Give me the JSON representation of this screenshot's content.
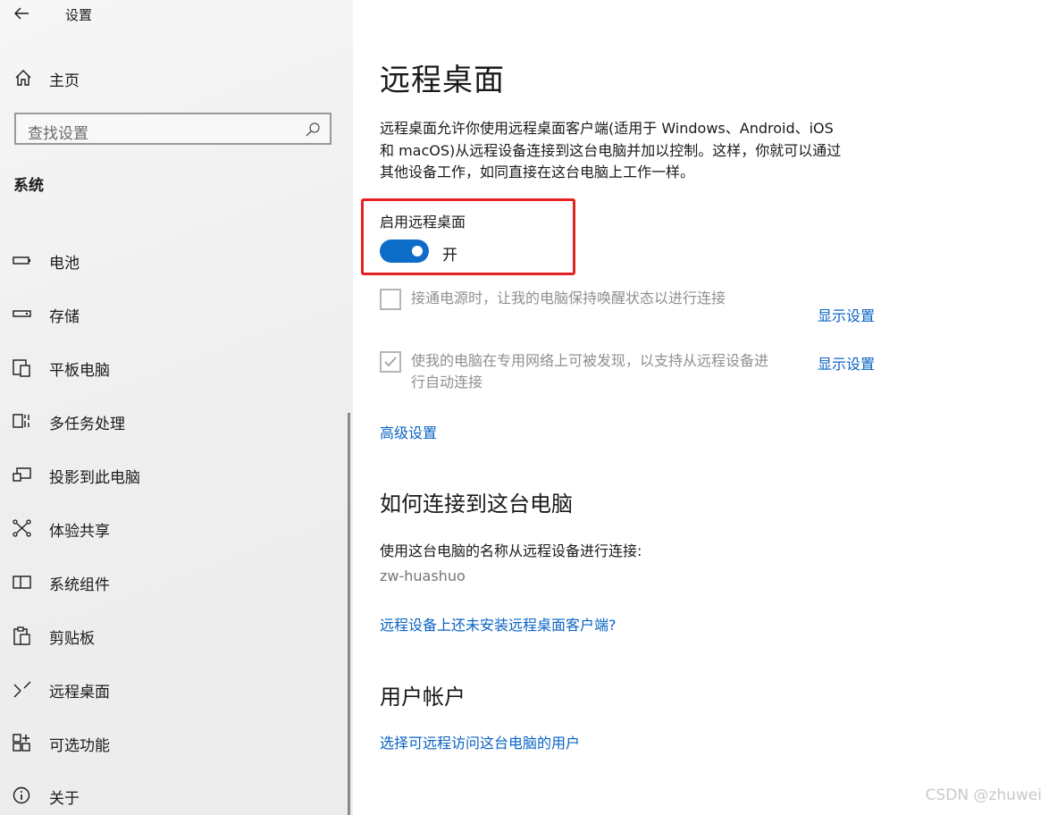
{
  "app": {
    "title": "设置"
  },
  "sidebar": {
    "home_label": "主页",
    "search": {
      "placeholder": "查找设置"
    },
    "section_title": "系统",
    "items": [
      {
        "label": "电池",
        "icon": "battery-icon"
      },
      {
        "label": "存储",
        "icon": "storage-icon"
      },
      {
        "label": "平板电脑",
        "icon": "tablet-icon"
      },
      {
        "label": "多任务处理",
        "icon": "multitasking-icon"
      },
      {
        "label": "投影到此电脑",
        "icon": "project-icon"
      },
      {
        "label": "体验共享",
        "icon": "share-icon"
      },
      {
        "label": "系统组件",
        "icon": "components-icon"
      },
      {
        "label": "剪贴板",
        "icon": "clipboard-icon"
      },
      {
        "label": "远程桌面",
        "icon": "remote-desktop-icon"
      },
      {
        "label": "可选功能",
        "icon": "optional-features-icon"
      },
      {
        "label": "关于",
        "icon": "info-icon"
      }
    ]
  },
  "main": {
    "title": "远程桌面",
    "description_lines": [
      "远程桌面允许你使用远程桌面客户端(适用于 Windows、Android、iOS",
      "和 macOS)从远程设备连接到这台电脑并加以控制。这样，你就可以通过",
      "其他设备工作，如同直接在这台电脑上工作一样。"
    ],
    "toggle": {
      "label": "启用远程桌面",
      "state_text": "开",
      "on": true
    },
    "option1": {
      "text": "接通电源时，让我的电脑保持唤醒状态以进行连接",
      "checked": false,
      "link": "显示设置"
    },
    "option2": {
      "text_line1": "使我的电脑在专用网络上可被发现，以支持从远程设备进",
      "text_line2": "行自动连接",
      "checked": true,
      "link": "显示设置"
    },
    "advanced_link": "高级设置",
    "how_connect": {
      "heading": "如何连接到这台电脑",
      "instruction": "使用这台电脑的名称从远程设备进行连接:",
      "pc_name": "zw-huashuo",
      "no_client_link": "远程设备上还未安装远程桌面客户端?"
    },
    "user_accounts": {
      "heading": "用户帐户",
      "link": "选择可远程访问这台电脑的用户"
    }
  },
  "watermark": "CSDN @zhuwei",
  "colors": {
    "accent": "#0e6cc9",
    "link": "#0a63c4",
    "highlight": "#e52222"
  }
}
